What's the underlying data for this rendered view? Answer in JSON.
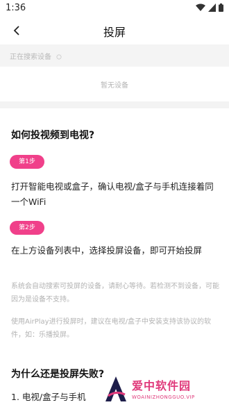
{
  "status_bar": {
    "time": "1:36",
    "icons": [
      "wifi-icon",
      "signal-icon",
      "battery-icon"
    ]
  },
  "header": {
    "title": "投屏",
    "back_icon": "chevron-left-icon"
  },
  "search": {
    "status": "正在搜索设备"
  },
  "devices": {
    "empty_text": "暂无设备"
  },
  "guide": {
    "heading": "如何投视频到电视?",
    "steps": [
      {
        "badge": "第1步",
        "text": "打开智能电视或盒子，确认电视/盒子与手机连接着同一个WiFi"
      },
      {
        "badge": "第2步",
        "text": "在上方设备列表中，选择投屏设备，即可开始投屏"
      }
    ],
    "notes": [
      "系统会自动搜索可投屏的设备，请耐心等待。若检测不到设备，可能因为是设备不支持。",
      "使用AirPlay进行投屏时，建议在电视/盒子中安装支持该协议的软件，如：乐播投屏。"
    ]
  },
  "faq": {
    "heading": "为什么还是投屏失败?",
    "item1": "1. 电视/盒子与手机"
  },
  "watermark": {
    "name": "爱中软件园",
    "url": "WOAINIZHONGGUO.VIP"
  },
  "colors": {
    "accent": "#f0408a"
  }
}
